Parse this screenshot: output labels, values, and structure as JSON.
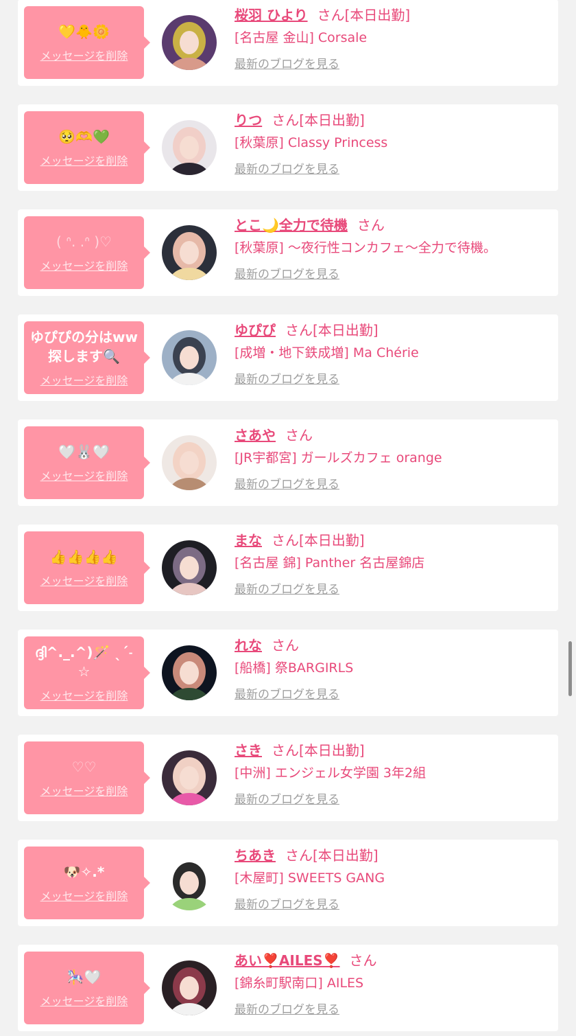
{
  "cards": [
    {
      "message": "💛🐥🌼",
      "delete_label": "メッセージを削除",
      "name": "桜羽 ひより",
      "san": "さん",
      "status": "[本日出勤]",
      "shop": "[名古屋 金山] Corsale",
      "blog_label": "最新のブログを見る",
      "avatar_colors": [
        "#5a3b6e",
        "#d89a8a",
        "#c9b145"
      ]
    },
    {
      "message": "🥺🫶💚",
      "delete_label": "メッセージを削除",
      "name": "りつ",
      "san": "さん",
      "status": "[本日出勤]",
      "shop": "[秋葉原] Classy Princess",
      "blog_label": "最新のブログを見る",
      "avatar_colors": [
        "#e9e6ea",
        "#2a2530",
        "#f1cfc8"
      ]
    },
    {
      "message": "( ᐢ. .ᐢ )♡",
      "delete_label": "メッセージを削除",
      "name": "とこ🌙全力で待機",
      "san": "さん",
      "status": "",
      "shop": "[秋葉原] 〜夜行性コンカフェ〜全力で待機。",
      "blog_label": "最新のブログを見る",
      "avatar_colors": [
        "#2b2f3a",
        "#f0d9a0",
        "#e6b9a8"
      ]
    },
    {
      "message": "ゆぴぴの分はww探します🔍",
      "delete_label": "メッセージを削除",
      "name": "ゆぴぴ",
      "san": "さん",
      "status": "[本日出勤]",
      "shop": "[成増・地下鉄成増] Ma Chérie",
      "blog_label": "最新のブログを見る",
      "avatar_colors": [
        "#9db0c6",
        "#f2f2f2",
        "#3b4250"
      ]
    },
    {
      "message": "🤍🐰🤍",
      "delete_label": "メッセージを削除",
      "name": "さあや",
      "san": "さん",
      "status": "",
      "shop": "[JR宇都宮] ガールズカフェ orange",
      "blog_label": "最新のブログを見る",
      "avatar_colors": [
        "#efe8e4",
        "#b78d72",
        "#f3d3c5"
      ]
    },
    {
      "message": "👍👍👍👍",
      "delete_label": "メッセージを削除",
      "name": "まな",
      "san": "さん",
      "status": "[本日出勤]",
      "shop": "[名古屋 錦] Panther 名古屋錦店",
      "blog_label": "最新のブログを見る",
      "avatar_colors": [
        "#1e1e24",
        "#e7c6c2",
        "#7c6b84"
      ]
    },
    {
      "message": "ദ്ദി^._.^)🪄 ˎˊ˗☆",
      "delete_label": "メッセージを削除",
      "name": "れな",
      "san": "さん",
      "status": "",
      "shop": "[船橋] 祭BARGIRLS",
      "blog_label": "最新のブログを見る",
      "avatar_colors": [
        "#0e1420",
        "#2e4a33",
        "#c98a7a"
      ]
    },
    {
      "message": "♡♡",
      "delete_label": "メッセージを削除",
      "name": "さき",
      "san": "さん",
      "status": "[本日出勤]",
      "shop": "[中洲] エンジェル女学園 3年2組",
      "blog_label": "最新のブログを見る",
      "avatar_colors": [
        "#3a2b3a",
        "#e85aa8",
        "#f0d0c4"
      ]
    },
    {
      "message": "🐶✧.*",
      "delete_label": "メッセージを削除",
      "name": "ちあき",
      "san": "さん",
      "status": "[本日出勤]",
      "shop": "[木屋町] SWEETS GANG",
      "blog_label": "最新のブログを見る",
      "avatar_colors": [
        "#ffffff",
        "#9ad27a",
        "#2b2b2b"
      ]
    },
    {
      "message": "🎠🤍",
      "delete_label": "メッセージを削除",
      "name": "あい❣️AILES❣️",
      "san": "さん",
      "status": "",
      "shop": "[錦糸町駅南口] AILES",
      "blog_label": "最新のブログを見る",
      "avatar_colors": [
        "#2a2024",
        "#f2f2f2",
        "#8b3a4a"
      ]
    }
  ]
}
